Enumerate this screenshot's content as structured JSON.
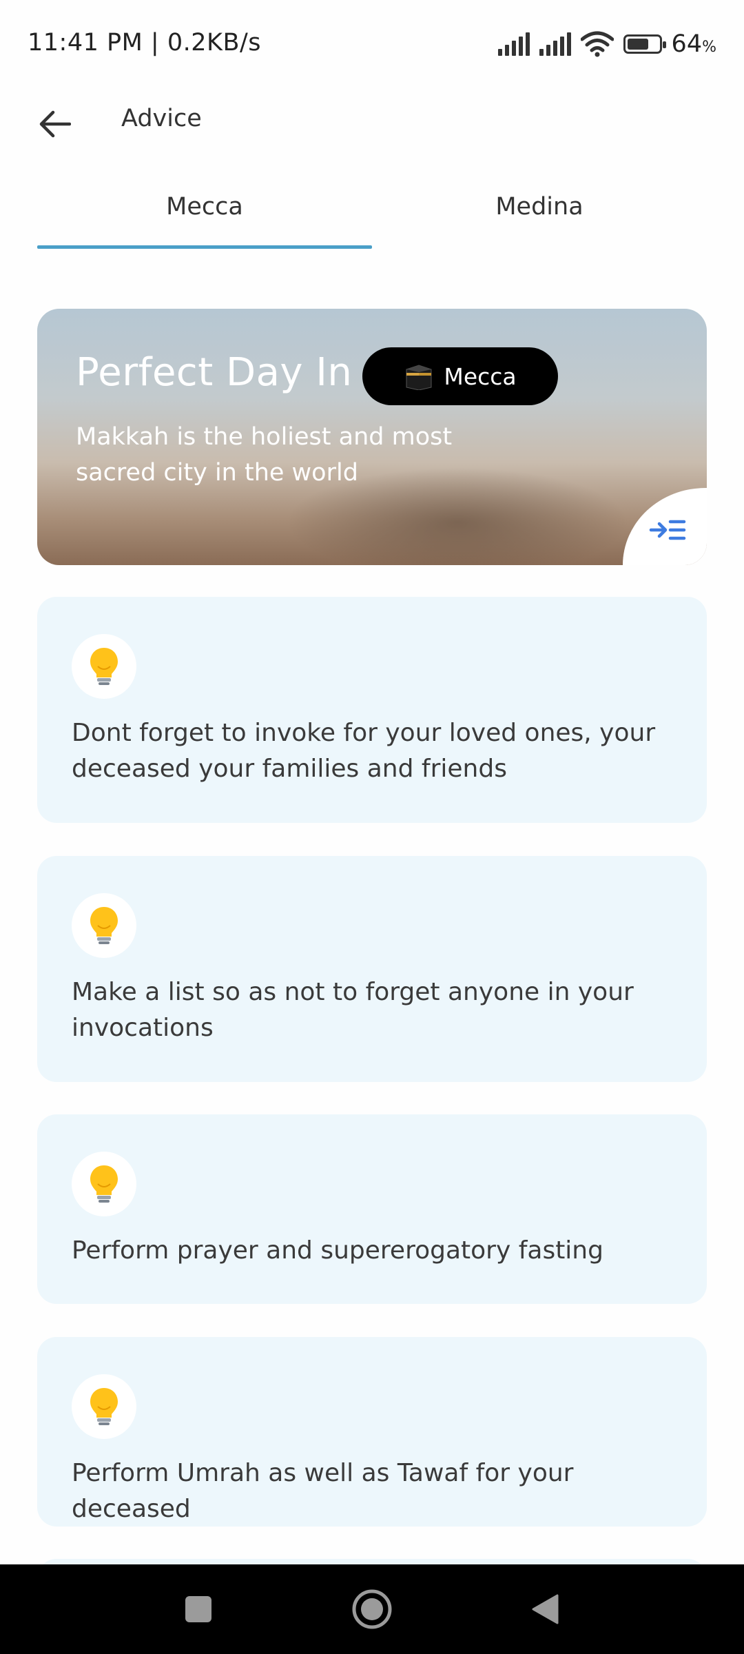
{
  "status_bar": {
    "time": "11:41 PM | 0.2KB/s",
    "battery": "64",
    "battery_unit": "%",
    "battery_level": 0.64
  },
  "header": {
    "title": "Advice",
    "back_icon": "arrow-left-icon"
  },
  "tabs": [
    {
      "label": "Mecca",
      "active": true
    },
    {
      "label": "Medina",
      "active": false
    }
  ],
  "colors": {
    "tab_indicator": "#4a9fc8",
    "card_background": "#edf7fc",
    "expand_icon": "#3d7be0"
  },
  "hero": {
    "title": "Perfect Day In",
    "chip_label": "Mecca",
    "chip_icon": "kaaba-icon",
    "subtitle": "Makkah is the holiest and most sacred city in the world",
    "corner_icon": "expand-list-icon"
  },
  "tips": [
    {
      "icon": "lightbulb-icon",
      "text": "Dont forget to invoke for your loved ones, your deceased your families and friends"
    },
    {
      "icon": "lightbulb-icon",
      "text": "Make a list so as not to forget anyone in your invocations"
    },
    {
      "icon": "lightbulb-icon",
      "text": "Perform prayer and supererogatory fasting"
    },
    {
      "icon": "lightbulb-icon",
      "text": "Perform Umrah as well as Tawaf for your deceased"
    }
  ]
}
